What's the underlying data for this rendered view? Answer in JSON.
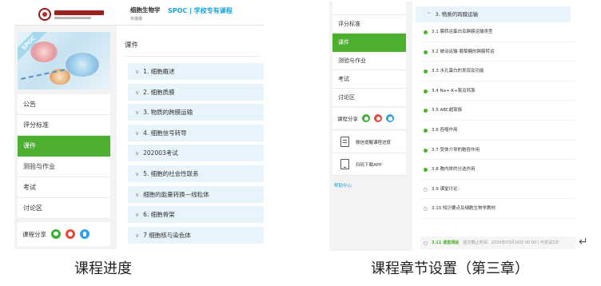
{
  "left": {
    "course_name": "细胞生物学",
    "teacher_name": "朱娜娜",
    "course_tag": "SPOC | 学校专有课程",
    "cover_ribbon": "SPOC",
    "nav": [
      "公告",
      "评分标准",
      "课件",
      "测验与作业",
      "考试",
      "讨论区"
    ],
    "active_nav": "课件",
    "share_label": "课程分享",
    "main_title": "课件",
    "chapters": [
      "1. 细胞概述",
      "2. 细胞质膜",
      "3. 物质的跨膜运输",
      "4. 细胞信号转导",
      "202003考试",
      "5. 细胞的社会性联系",
      "细胞的能量转换—线粒体",
      "6. 细胞骨架",
      "7 细胞核与染色体"
    ]
  },
  "right": {
    "nav": [
      "评分标准",
      "课件",
      "测验与作业",
      "考试",
      "讨论区"
    ],
    "active_nav": "课件",
    "share_label": "课程分享",
    "actions": [
      "微信提醒课程进度",
      "扫码下载APP"
    ],
    "help_label": "帮助中心",
    "section_title": "3. 物质的跨膜运输",
    "lessons": [
      {
        "title": "3.1 膜转运蛋白及跨膜运输类型",
        "done": true
      },
      {
        "title": "3.2 被动运输-葡萄糖的跨膜转运",
        "done": true
      },
      {
        "title": "3.3 水孔蛋白的发现及功能",
        "done": true
      },
      {
        "title": "3.4 Na+-K+泵及钙泵",
        "done": true
      },
      {
        "title": "3.5 ABC超家族",
        "done": true
      },
      {
        "title": "3.6 吞噬作用",
        "done": true
      },
      {
        "title": "3.7 受体介导的胞吞作用",
        "done": true
      },
      {
        "title": "3.8 胞内体的分选作用",
        "done": true
      },
      {
        "title": "3.9 课堂讨论",
        "done": false
      },
      {
        "title": "3.10 知识要点及细胞生物学教材",
        "done": false
      }
    ],
    "quiz_label": "3.11 课堂测验",
    "quiz_meta": "提交截止时间：2020年03月16日 00:00 | 可尝试3次"
  },
  "captions": {
    "left": "课程进度",
    "right": "课程章节设置（第三章）"
  },
  "colors": {
    "accent_green": "#4caf2f",
    "accent_blue": "#19a5d8",
    "chapter_bg": "#e8f4fb",
    "exam_bg": "#f6f2c6"
  }
}
